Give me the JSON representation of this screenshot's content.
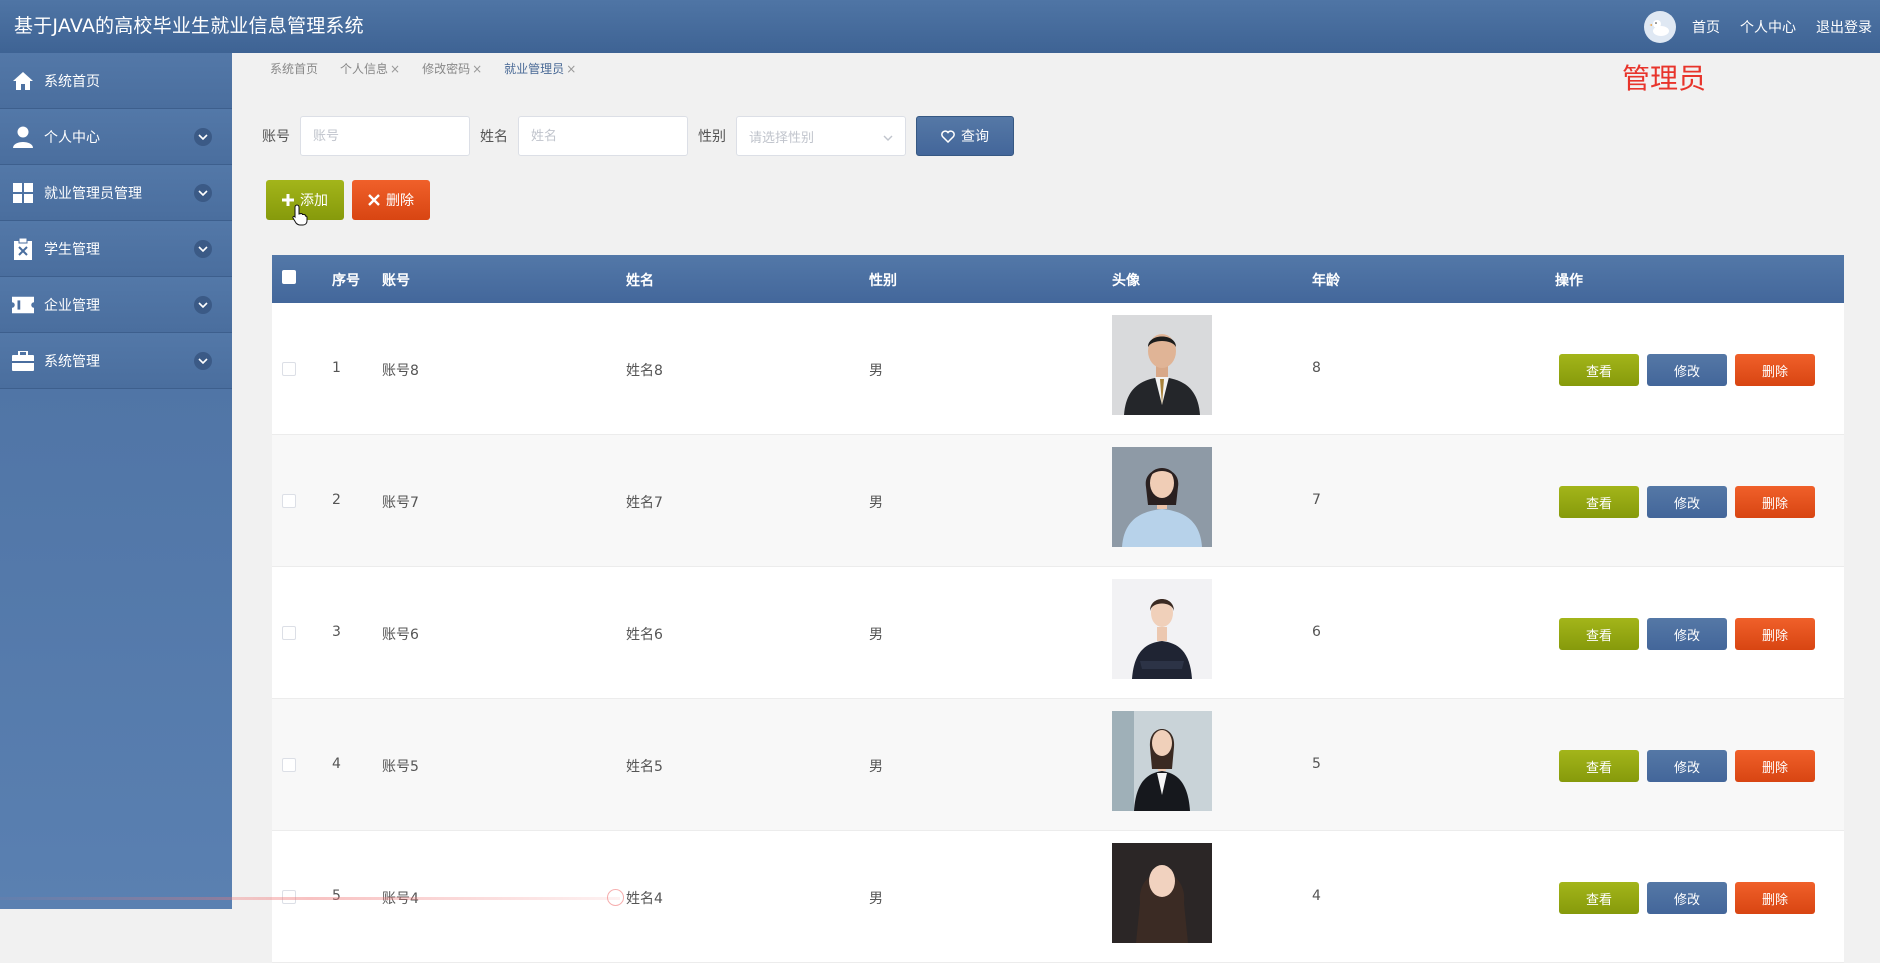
{
  "header": {
    "title": "基于JAVA的高校毕业生就业信息管理系统",
    "links": [
      "首页",
      "个人中心",
      "退出登录"
    ]
  },
  "sidebar": {
    "items": [
      {
        "label": "系统首页",
        "icon": "home-icon"
      },
      {
        "label": "个人中心",
        "icon": "user-icon"
      },
      {
        "label": "就业管理员管理",
        "icon": "grid-icon"
      },
      {
        "label": "学生管理",
        "icon": "clipboard-icon"
      },
      {
        "label": "企业管理",
        "icon": "ticket-icon"
      },
      {
        "label": "系统管理",
        "icon": "briefcase-icon"
      }
    ]
  },
  "tabs": [
    {
      "label": "系统首页"
    },
    {
      "label": "个人信息",
      "close": "×"
    },
    {
      "label": "修改密码",
      "close": "×"
    },
    {
      "label": "就业管理员",
      "close": "×"
    }
  ],
  "role_label": "管理员",
  "search": {
    "account_label": "账号",
    "account_placeholder": "账号",
    "name_label": "姓名",
    "name_placeholder": "姓名",
    "gender_label": "性别",
    "gender_placeholder": "请选择性别",
    "query_button": "查询"
  },
  "actions": {
    "add": "添加",
    "delete": "删除"
  },
  "table": {
    "headers": [
      "序号",
      "账号",
      "姓名",
      "性别",
      "头像",
      "年龄",
      "操作"
    ],
    "rows": [
      {
        "index": "1",
        "account": "账号8",
        "name": "姓名8",
        "gender": "男",
        "age": "8",
        "photo": "man-suit"
      },
      {
        "index": "2",
        "account": "账号7",
        "name": "姓名7",
        "gender": "男",
        "age": "7",
        "photo": "woman-blue-shirt"
      },
      {
        "index": "3",
        "account": "账号6",
        "name": "姓名6",
        "gender": "男",
        "age": "6",
        "photo": "woman-navy-dress"
      },
      {
        "index": "4",
        "account": "账号5",
        "name": "姓名5",
        "gender": "男",
        "age": "5",
        "photo": "woman-blazer"
      },
      {
        "index": "5",
        "account": "账号4",
        "name": "姓名4",
        "gender": "男",
        "age": "4",
        "photo": "woman-dark-hair"
      }
    ],
    "row_buttons": {
      "view": "查看",
      "edit": "修改",
      "delete": "删除"
    }
  },
  "colors": {
    "primary": "#4a6e9f",
    "add": "#95a812",
    "delete": "#e5501d",
    "role": "#e8342b"
  }
}
